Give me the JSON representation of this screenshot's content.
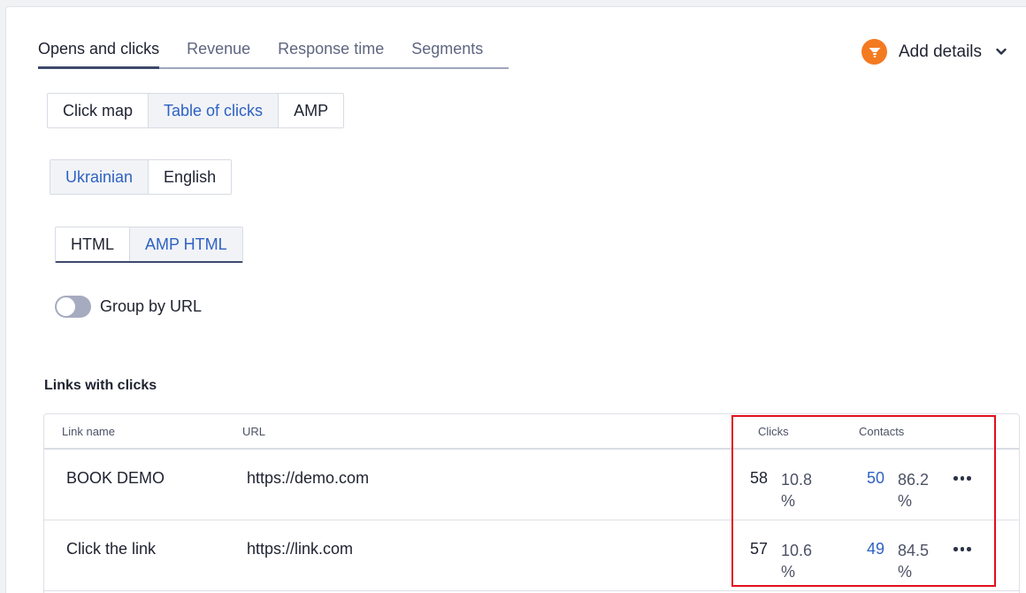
{
  "tabs": [
    {
      "label": "Opens and clicks",
      "active": true
    },
    {
      "label": "Revenue",
      "active": false
    },
    {
      "label": "Response time",
      "active": false
    },
    {
      "label": "Segments",
      "active": false
    }
  ],
  "add_details": {
    "label": "Add details",
    "icon": "funnel-icon",
    "accent_color": "#f47a20"
  },
  "view_switch": {
    "options": [
      "Click map",
      "Table of clicks",
      "AMP"
    ],
    "selected": "Table of clicks"
  },
  "language_switch": {
    "options": [
      "Ukrainian",
      "English"
    ],
    "selected": "Ukrainian"
  },
  "format_switch": {
    "options": [
      "HTML",
      "AMP HTML"
    ],
    "selected": "AMP HTML"
  },
  "group_toggle": {
    "label": "Group by URL",
    "on": false
  },
  "links_section": {
    "title": "Links with clicks",
    "columns": {
      "link_name": "Link name",
      "url": "URL",
      "clicks": "Clicks",
      "contacts": "Contacts"
    },
    "rows": [
      {
        "name": "BOOK DEMO",
        "url": "https://demo.com",
        "clicks": "58",
        "clicks_pct": "10.8 %",
        "contacts": "50",
        "contacts_pct": "86.2 %"
      },
      {
        "name": "Click the link",
        "url": "https://link.com",
        "clicks": "57",
        "clicks_pct": "10.6 %",
        "contacts": "49",
        "contacts_pct": "84.5 %"
      }
    ]
  },
  "colors": {
    "link_blue": "#2f62c2",
    "highlight_red": "#e0101c",
    "tab_underline": "#3e4a6b"
  }
}
